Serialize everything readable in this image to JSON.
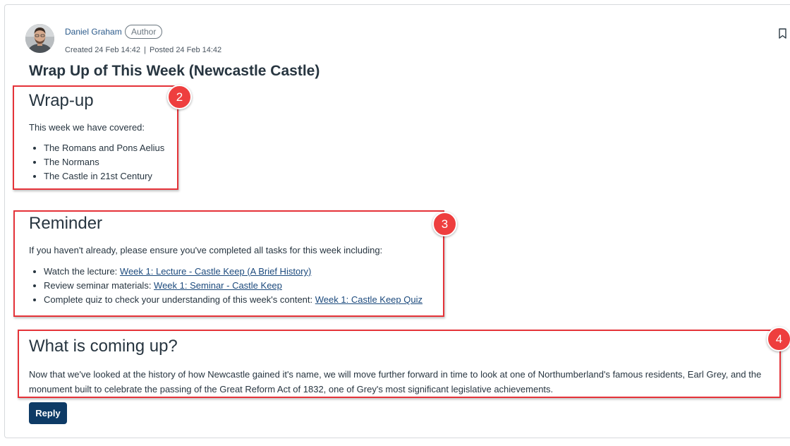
{
  "post": {
    "author": {
      "name": "Daniel Graham",
      "badge": "Author",
      "avatar_icon": "person-avatar"
    },
    "meta": {
      "created": "Created 24 Feb 14:42",
      "separator": "|",
      "posted": "Posted 24 Feb 14:42"
    },
    "bookmark_icon": "bookmark-icon",
    "title": "Wrap Up of This Week (Newcastle Castle)"
  },
  "sections": {
    "wrapup": {
      "heading": "Wrap-up",
      "intro": "This week we have covered:",
      "items": [
        "The Romans and Pons Aelius",
        "The Normans",
        "The Castle in 21st Century"
      ]
    },
    "reminder": {
      "heading": "Reminder",
      "intro": "If you haven't already, please ensure you've completed all tasks for this week including:",
      "items": [
        {
          "prefix": "Watch the lecture: ",
          "link": "Week 1: Lecture - Castle Keep (A Brief History)"
        },
        {
          "prefix": "Review seminar materials: ",
          "link": "Week 1: Seminar - Castle Keep"
        },
        {
          "prefix": "Complete quiz to check your understanding of this week's content: ",
          "link": "Week 1: Castle Keep Quiz"
        }
      ]
    },
    "coming_up": {
      "heading": "What is coming up?",
      "body": "Now that we've looked at the history of how Newcastle gained it's name, we will move further forward in time to look at one of Northumberland's famous residents, Earl Grey, and the monument built to celebrate the passing of the Great Reform Act of 1832, one of Grey's most significant legislative achievements."
    }
  },
  "annotations": {
    "badge_2": "2",
    "badge_3": "3",
    "badge_4": "4",
    "color": "#e53339"
  },
  "actions": {
    "reply": "Reply"
  },
  "colors": {
    "link": "#1c4a7d",
    "button": "#0e3b66",
    "text": "#273540"
  }
}
